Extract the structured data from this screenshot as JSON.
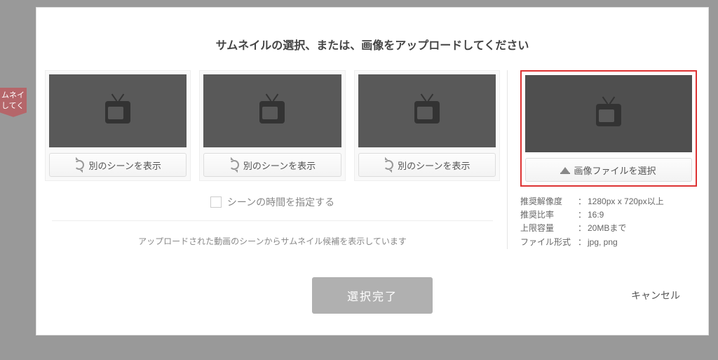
{
  "bg_tag": "ムネイ\nしてく",
  "modal": {
    "title": "サムネイルの選択、または、画像をアップロードしてください",
    "scenes": [
      {
        "button_label": "別のシーンを表示"
      },
      {
        "button_label": "別のシーンを表示"
      },
      {
        "button_label": "別のシーンを表示"
      }
    ],
    "checkbox_label": "シーンの時間を指定する",
    "info": "アップロードされた動画のシーンからサムネイル候補を表示しています",
    "upload_button": "画像ファイルを選択",
    "specs": {
      "resolution_label": "推奨解像度",
      "resolution_value": "1280px x 720px以上",
      "ratio_label": "推奨比率",
      "ratio_value": "16:9",
      "size_label": "上限容量",
      "size_value": "20MBまで",
      "format_label": "ファイル形式",
      "format_value": "jpg, png"
    },
    "submit": "選択完了",
    "cancel": "キャンセル"
  }
}
